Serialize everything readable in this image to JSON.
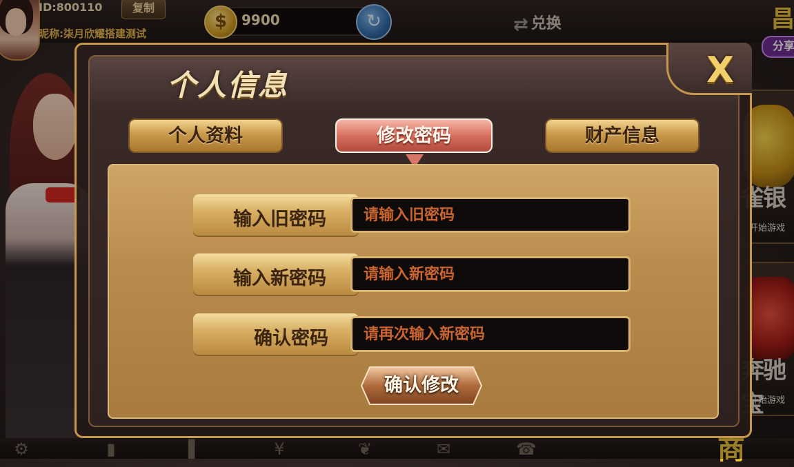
{
  "user": {
    "id_label": "ID:800110",
    "copy_label": "复制",
    "nickname": "昵称:柒月欣耀搭建测试"
  },
  "currency": {
    "coin_symbol": "$",
    "balance": "9900",
    "refresh_icon": "refresh-icon",
    "exchange_label": "兑换"
  },
  "share": {
    "label": "分享",
    "top_glyph": "昌"
  },
  "side_games": [
    {
      "title": "雀银",
      "subtitle": "开始游戏"
    },
    {
      "title": "奔驰宝",
      "subtitle": "开始游戏"
    }
  ],
  "shop_label": "商",
  "dialog": {
    "title": "个人信息",
    "close_label": "X",
    "tabs": [
      {
        "label": "个人资料",
        "active": false
      },
      {
        "label": "修改密码",
        "active": true
      },
      {
        "label": "财产信息",
        "active": false
      }
    ],
    "form": {
      "old_password": {
        "label": "输入旧密码",
        "placeholder": "请输入旧密码"
      },
      "new_password": {
        "label": "输入新密码",
        "placeholder": "请输入新密码"
      },
      "confirm_password": {
        "label": "确认密码",
        "placeholder": "请再次输入新密码"
      }
    },
    "confirm_button": "确认修改"
  },
  "colors": {
    "accent_gold": "#c7984c",
    "active_tab": "#d9705e",
    "placeholder_text": "#c9642f",
    "panel": "#b88c4d"
  },
  "bottom_icons": [
    "settings-icon",
    "speaker-icon",
    "ranking-icon",
    "bank-icon",
    "gift-icon",
    "mail-icon",
    "service-icon"
  ]
}
